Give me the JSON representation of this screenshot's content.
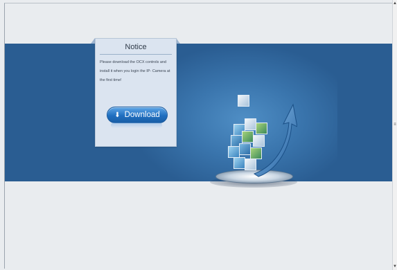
{
  "notice": {
    "title": "Notice",
    "message": "Please download the OCX controls and install it when you login the IP- Camera at the first time!",
    "download_label": "Download",
    "download_icon": "download-arrow-icon"
  },
  "illustration": {
    "icon": "media-cubes-graphic"
  },
  "scrollbar": {
    "up_icon": "scroll-up-arrow-icon",
    "down_icon": "scroll-down-arrow-icon",
    "grip_icon": "scroll-grip-icon"
  },
  "colors": {
    "band": "#2a5d92",
    "page_background": "#e9ecef",
    "notice_panel": "#dbe4f0",
    "button": "#1f6fc0"
  }
}
